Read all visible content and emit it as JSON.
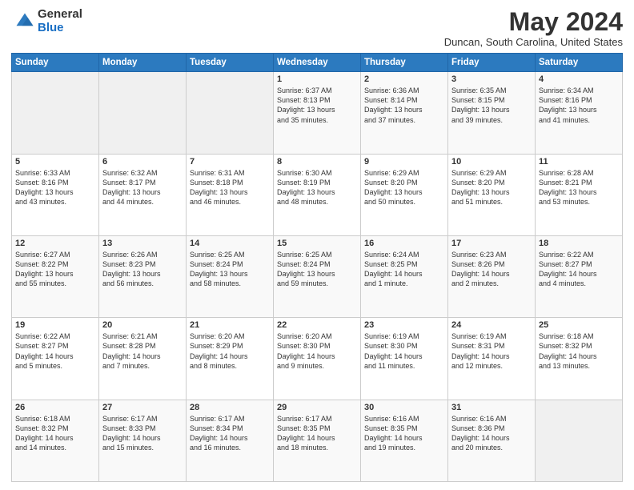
{
  "header": {
    "logo_general": "General",
    "logo_blue": "Blue",
    "title": "May 2024",
    "location": "Duncan, South Carolina, United States"
  },
  "days_of_week": [
    "Sunday",
    "Monday",
    "Tuesday",
    "Wednesday",
    "Thursday",
    "Friday",
    "Saturday"
  ],
  "weeks": [
    [
      {
        "day": "",
        "info": ""
      },
      {
        "day": "",
        "info": ""
      },
      {
        "day": "",
        "info": ""
      },
      {
        "day": "1",
        "info": "Sunrise: 6:37 AM\nSunset: 8:13 PM\nDaylight: 13 hours\nand 35 minutes."
      },
      {
        "day": "2",
        "info": "Sunrise: 6:36 AM\nSunset: 8:14 PM\nDaylight: 13 hours\nand 37 minutes."
      },
      {
        "day": "3",
        "info": "Sunrise: 6:35 AM\nSunset: 8:15 PM\nDaylight: 13 hours\nand 39 minutes."
      },
      {
        "day": "4",
        "info": "Sunrise: 6:34 AM\nSunset: 8:16 PM\nDaylight: 13 hours\nand 41 minutes."
      }
    ],
    [
      {
        "day": "5",
        "info": "Sunrise: 6:33 AM\nSunset: 8:16 PM\nDaylight: 13 hours\nand 43 minutes."
      },
      {
        "day": "6",
        "info": "Sunrise: 6:32 AM\nSunset: 8:17 PM\nDaylight: 13 hours\nand 44 minutes."
      },
      {
        "day": "7",
        "info": "Sunrise: 6:31 AM\nSunset: 8:18 PM\nDaylight: 13 hours\nand 46 minutes."
      },
      {
        "day": "8",
        "info": "Sunrise: 6:30 AM\nSunset: 8:19 PM\nDaylight: 13 hours\nand 48 minutes."
      },
      {
        "day": "9",
        "info": "Sunrise: 6:29 AM\nSunset: 8:20 PM\nDaylight: 13 hours\nand 50 minutes."
      },
      {
        "day": "10",
        "info": "Sunrise: 6:29 AM\nSunset: 8:20 PM\nDaylight: 13 hours\nand 51 minutes."
      },
      {
        "day": "11",
        "info": "Sunrise: 6:28 AM\nSunset: 8:21 PM\nDaylight: 13 hours\nand 53 minutes."
      }
    ],
    [
      {
        "day": "12",
        "info": "Sunrise: 6:27 AM\nSunset: 8:22 PM\nDaylight: 13 hours\nand 55 minutes."
      },
      {
        "day": "13",
        "info": "Sunrise: 6:26 AM\nSunset: 8:23 PM\nDaylight: 13 hours\nand 56 minutes."
      },
      {
        "day": "14",
        "info": "Sunrise: 6:25 AM\nSunset: 8:24 PM\nDaylight: 13 hours\nand 58 minutes."
      },
      {
        "day": "15",
        "info": "Sunrise: 6:25 AM\nSunset: 8:24 PM\nDaylight: 13 hours\nand 59 minutes."
      },
      {
        "day": "16",
        "info": "Sunrise: 6:24 AM\nSunset: 8:25 PM\nDaylight: 14 hours\nand 1 minute."
      },
      {
        "day": "17",
        "info": "Sunrise: 6:23 AM\nSunset: 8:26 PM\nDaylight: 14 hours\nand 2 minutes."
      },
      {
        "day": "18",
        "info": "Sunrise: 6:22 AM\nSunset: 8:27 PM\nDaylight: 14 hours\nand 4 minutes."
      }
    ],
    [
      {
        "day": "19",
        "info": "Sunrise: 6:22 AM\nSunset: 8:27 PM\nDaylight: 14 hours\nand 5 minutes."
      },
      {
        "day": "20",
        "info": "Sunrise: 6:21 AM\nSunset: 8:28 PM\nDaylight: 14 hours\nand 7 minutes."
      },
      {
        "day": "21",
        "info": "Sunrise: 6:20 AM\nSunset: 8:29 PM\nDaylight: 14 hours\nand 8 minutes."
      },
      {
        "day": "22",
        "info": "Sunrise: 6:20 AM\nSunset: 8:30 PM\nDaylight: 14 hours\nand 9 minutes."
      },
      {
        "day": "23",
        "info": "Sunrise: 6:19 AM\nSunset: 8:30 PM\nDaylight: 14 hours\nand 11 minutes."
      },
      {
        "day": "24",
        "info": "Sunrise: 6:19 AM\nSunset: 8:31 PM\nDaylight: 14 hours\nand 12 minutes."
      },
      {
        "day": "25",
        "info": "Sunrise: 6:18 AM\nSunset: 8:32 PM\nDaylight: 14 hours\nand 13 minutes."
      }
    ],
    [
      {
        "day": "26",
        "info": "Sunrise: 6:18 AM\nSunset: 8:32 PM\nDaylight: 14 hours\nand 14 minutes."
      },
      {
        "day": "27",
        "info": "Sunrise: 6:17 AM\nSunset: 8:33 PM\nDaylight: 14 hours\nand 15 minutes."
      },
      {
        "day": "28",
        "info": "Sunrise: 6:17 AM\nSunset: 8:34 PM\nDaylight: 14 hours\nand 16 minutes."
      },
      {
        "day": "29",
        "info": "Sunrise: 6:17 AM\nSunset: 8:35 PM\nDaylight: 14 hours\nand 18 minutes."
      },
      {
        "day": "30",
        "info": "Sunrise: 6:16 AM\nSunset: 8:35 PM\nDaylight: 14 hours\nand 19 minutes."
      },
      {
        "day": "31",
        "info": "Sunrise: 6:16 AM\nSunset: 8:36 PM\nDaylight: 14 hours\nand 20 minutes."
      },
      {
        "day": "",
        "info": ""
      }
    ]
  ]
}
